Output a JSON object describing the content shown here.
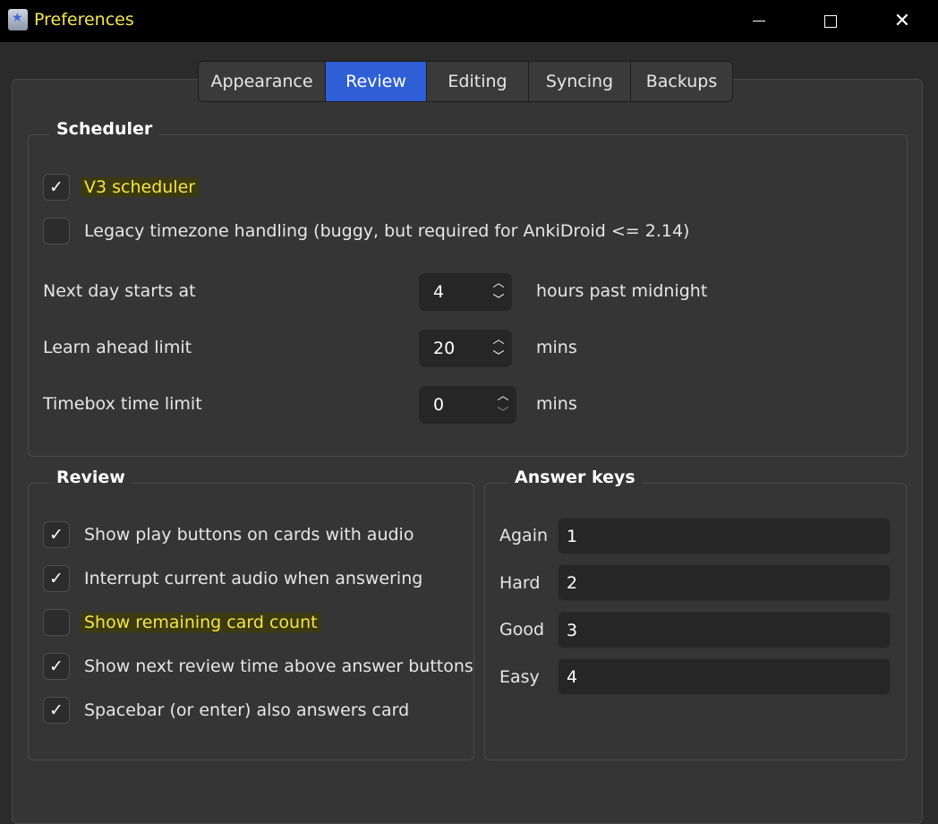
{
  "window": {
    "title": "Preferences",
    "app_icon": "anki-star-icon",
    "controls": [
      "minimize-icon",
      "maximize-icon",
      "close-icon"
    ]
  },
  "tabs": [
    {
      "label": "Appearance",
      "active": false
    },
    {
      "label": "Review",
      "active": true
    },
    {
      "label": "Editing",
      "active": false
    },
    {
      "label": "Syncing",
      "active": false
    },
    {
      "label": "Backups",
      "active": false
    }
  ],
  "scheduler": {
    "title": "Scheduler",
    "v3": {
      "label": "V3 scheduler",
      "checked": true,
      "highlighted": true
    },
    "legacy_tz": {
      "label": "Legacy timezone handling (buggy, but required for AnkiDroid <= 2.14)",
      "checked": false
    },
    "next_day": {
      "label": "Next day starts at",
      "value": "4",
      "unit": "hours past midnight"
    },
    "learn_ahead": {
      "label": "Learn ahead limit",
      "value": "20",
      "unit": "mins"
    },
    "timebox": {
      "label": "Timebox time limit",
      "value": "0",
      "unit": "mins"
    }
  },
  "review": {
    "title": "Review",
    "options": [
      {
        "label": "Show play buttons on cards with audio",
        "checked": true,
        "highlighted": false
      },
      {
        "label": "Interrupt current audio when answering",
        "checked": true,
        "highlighted": false
      },
      {
        "label": "Show remaining card count",
        "checked": false,
        "highlighted": true
      },
      {
        "label": "Show next review time above answer buttons",
        "checked": true,
        "highlighted": false
      },
      {
        "label": "Spacebar (or enter) also answers card",
        "checked": true,
        "highlighted": false
      }
    ]
  },
  "answer_keys": {
    "title": "Answer keys",
    "keys": [
      {
        "label": "Again",
        "value": "1"
      },
      {
        "label": "Hard",
        "value": "2"
      },
      {
        "label": "Good",
        "value": "3"
      },
      {
        "label": "Easy",
        "value": "4"
      }
    ]
  },
  "colors": {
    "accent": "#2f5fd6",
    "highlight_text": "#f4e54a",
    "background": "#2b2b2b"
  }
}
